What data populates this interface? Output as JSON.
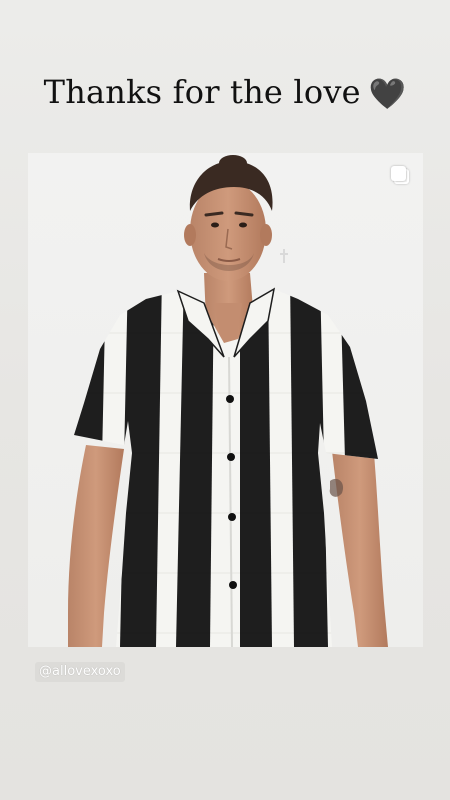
{
  "story": {
    "headline_text": "Thanks for the love",
    "headline_emoji": "🖤",
    "mention": "@allovexoxo"
  },
  "post": {
    "multiple_media_icon": "multiple-photos-icon",
    "image_description_icon": "product-photo"
  },
  "colors": {
    "background": "#e8e7e4",
    "headline_text": "#111111",
    "shirt_black": "#1e1e1e",
    "shirt_white": "#f5f5f2",
    "mention_text": "#ffffff"
  }
}
